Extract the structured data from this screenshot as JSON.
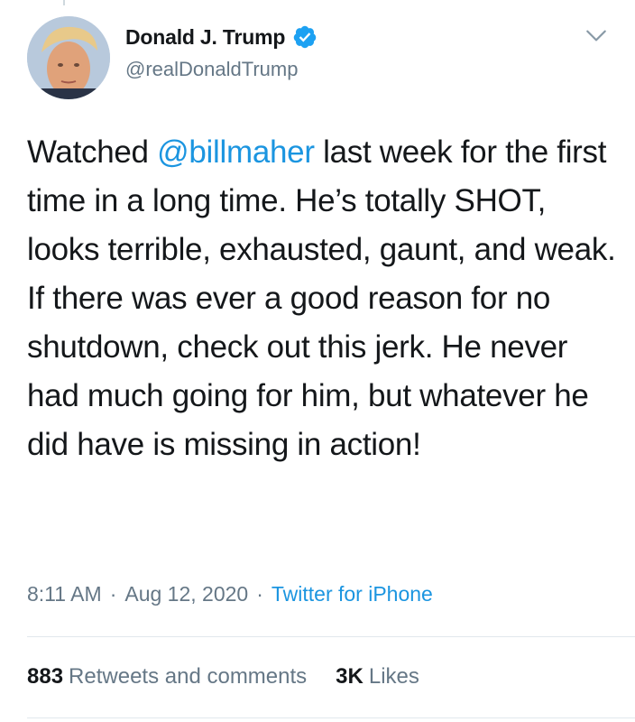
{
  "author": {
    "display_name": "Donald J. Trump",
    "handle": "@realDonaldTrump",
    "verified": true
  },
  "tweet": {
    "segments": [
      {
        "type": "text",
        "text": "Watched "
      },
      {
        "type": "mention",
        "text": "@billmaher"
      },
      {
        "type": "text",
        "text": " last week for the first time in a long time. He’s totally SHOT, looks terrible, exhausted, gaunt, and weak. If there was ever a good reason for no shutdown, check out this jerk. He never had much going for him, but whatever he did have is missing in action!"
      }
    ]
  },
  "meta": {
    "time": "8:11 AM",
    "date": "Aug 12, 2020",
    "separator": "·",
    "source": "Twitter for iPhone"
  },
  "stats": {
    "retweets_count": "883",
    "retweets_label": "Retweets and comments",
    "likes_count": "3K",
    "likes_label": "Likes"
  },
  "colors": {
    "link": "#1b95e0",
    "secondary_text": "#657786",
    "primary_text": "#14171a",
    "divider": "#e1e8ed",
    "verified_badge": "#1da1f2"
  },
  "icons": [
    "verified-badge-icon",
    "chevron-down-icon"
  ]
}
